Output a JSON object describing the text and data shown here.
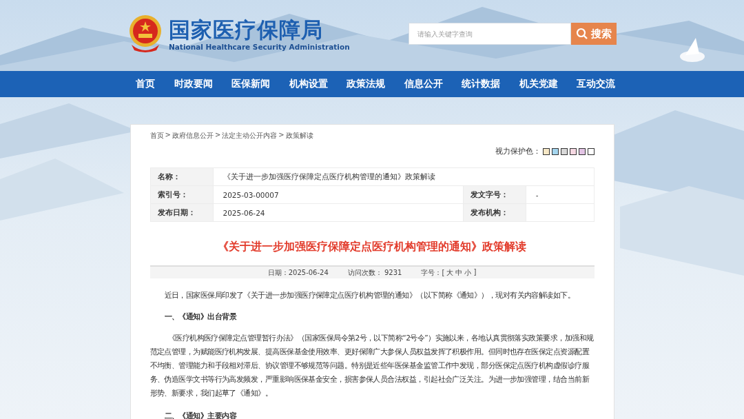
{
  "header": {
    "logo_title": "国家医疗保障局",
    "logo_subtitle": "National Healthcare Security Administration",
    "search": {
      "placeholder": "请输入关键字查询",
      "button": "搜索"
    }
  },
  "nav": [
    {
      "label": "首页"
    },
    {
      "label": "时政要闻"
    },
    {
      "label": "医保新闻"
    },
    {
      "label": "机构设置"
    },
    {
      "label": "政策法规"
    },
    {
      "label": "信息公开"
    },
    {
      "label": "统计数据"
    },
    {
      "label": "机关党建"
    },
    {
      "label": "互动交流"
    }
  ],
  "breadcrumb": {
    "separator": ">",
    "items": [
      "首页",
      "政府信息公开",
      "法定主动公开内容",
      "政策解读"
    ]
  },
  "eye_care": {
    "label": "视力保护色：",
    "swatches": [
      {
        "color": "#f7e8c6"
      },
      {
        "color": "#a5d6ef"
      },
      {
        "color": "#d8d8d8"
      },
      {
        "color": "#f5d8e2"
      },
      {
        "color": "#e2c4e4"
      },
      {
        "color": "#ffffff"
      }
    ]
  },
  "meta": {
    "name_label": "名称：",
    "name": "《关于进一步加强医疗保障定点医疗机构管理的通知》政策解读",
    "index_label": "索引号：",
    "index": "2025-03-00007",
    "doc_no_label": "发文字号：",
    "doc_no": "-",
    "date_label": "发布日期：",
    "date": "2025-06-24",
    "org_label": "发布机构："
  },
  "article": {
    "title": "《关于进一步加强医疗保障定点医疗机构管理的通知》政策解读",
    "info": {
      "date": "日期：2025-06-24",
      "visits": "访问次数： 9231",
      "font_label": "字号：[",
      "font_sizes": [
        "大",
        "中",
        "小"
      ],
      "font_end": "]"
    },
    "blocks": [
      {
        "kind": "paragraph",
        "text": "近日，国家医保局印发了《关于进一步加强医疗保障定点医疗机构管理的通知》（以下简称《通知》），现对有关内容解读如下。"
      },
      {
        "kind": "heading",
        "text": "一、《通知》出台背景"
      },
      {
        "kind": "paragraph",
        "text": "《医疗机构医疗保障定点管理暂行办法》（国家医保局令第2号，以下简称“2号令”）实施以来，各地认真贯彻落实政策要求，加强和规范定点管理，为赋能医疗机构发展、提高医保基金使用效率、更好保障广大参保人员权益发挥了积极作用。但同时也存在医保定点资源配置不均衡、管理能力和手段相对滞后、协议管理不够规范等问题。特别是近些年医保基金监管工作中发现，部分医保定点医疗机构虚假诊疗服务、伪造医学文书等行为高发频发，严重影响医保基金安全，损害参保人员合法权益，引起社会广泛关注。为进一步加强管理，结合当前新形势、新要求，我们起草了《通知》。"
      },
      {
        "kind": "heading",
        "text": "二、《通知》主要内容"
      }
    ]
  }
}
